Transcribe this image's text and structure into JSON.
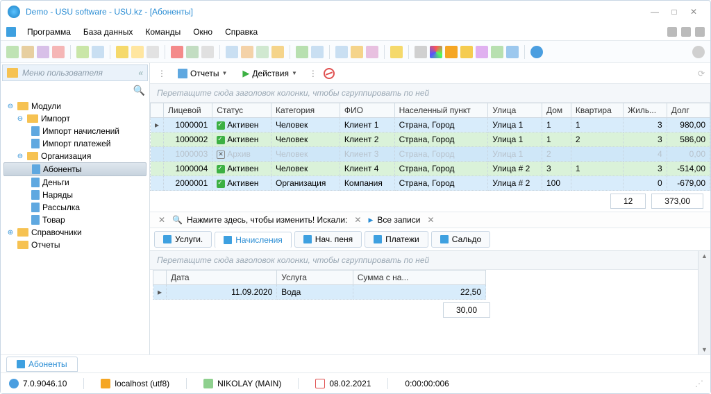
{
  "window": {
    "title": "Demo - USU software - USU.kz - [Абоненты]"
  },
  "menubar": {
    "items": [
      "Программа",
      "База данных",
      "Команды",
      "Окно",
      "Справка"
    ]
  },
  "sidebar": {
    "header": "Меню пользователя",
    "nodes": {
      "modules": "Модули",
      "import": "Импорт",
      "import_nach": "Импорт начислений",
      "import_plat": "Импорт платежей",
      "organization": "Организация",
      "abonents": "Абоненты",
      "money": "Деньги",
      "orders": "Наряды",
      "mailing": "Рассылка",
      "goods": "Товар",
      "refs": "Справочники",
      "reports": "Отчеты"
    }
  },
  "content_toolbar": {
    "reports": "Отчеты",
    "actions": "Действия"
  },
  "groupbar": "Перетащите сюда заголовок колонки, чтобы сгруппировать по ней",
  "grid": {
    "headers": [
      "Лицевой",
      "Статус",
      "Категория",
      "ФИО",
      "Населенный пункт",
      "Улица",
      "Дом",
      "Квартира",
      "Жиль...",
      "Долг"
    ],
    "rows": [
      {
        "acct": "1000001",
        "status": "Активен",
        "status_ok": true,
        "cat": "Человек",
        "fio": "Клиент 1",
        "city": "Страна, Город",
        "street": "Улица 1",
        "house": "1",
        "flat": "1",
        "people": "3",
        "debt": "980,00"
      },
      {
        "acct": "1000002",
        "status": "Активен",
        "status_ok": true,
        "cat": "Человек",
        "fio": "Клиент 2",
        "city": "Страна, Город",
        "street": "Улица 1",
        "house": "1",
        "flat": "2",
        "people": "3",
        "debt": "586,00"
      },
      {
        "acct": "1000003",
        "status": "Архив",
        "status_ok": false,
        "cat": "Человек",
        "fio": "Клиент 3",
        "city": "Страна, Город",
        "street": "Улица 1",
        "house": "2",
        "flat": "",
        "people": "4",
        "debt": "0,00",
        "inactive": true
      },
      {
        "acct": "1000004",
        "status": "Активен",
        "status_ok": true,
        "cat": "Человек",
        "fio": "Клиент 4",
        "city": "Страна, Город",
        "street": "Улица # 2",
        "house": "3",
        "flat": "1",
        "people": "3",
        "debt": "-514,00"
      },
      {
        "acct": "2000001",
        "status": "Активен",
        "status_ok": true,
        "cat": "Организация",
        "fio": "Компания",
        "city": "Страна, Город",
        "street": "Улица # 2",
        "house": "100",
        "flat": "",
        "people": "0",
        "debt": "-679,00"
      }
    ],
    "totals": {
      "count": "12",
      "sum": "373,00"
    }
  },
  "filterbar": {
    "text": "Нажмите здесь, чтобы изменить! Искали:",
    "all": "Все записи"
  },
  "subtabs": [
    "Услуги.",
    "Начисления",
    "Нач. пеня",
    "Платежи",
    "Сальдо"
  ],
  "subgrid": {
    "headers": [
      "Дата",
      "Услуга",
      "Сумма с на..."
    ],
    "rows": [
      {
        "date": "11.09.2020",
        "service": "Вода",
        "sum": "22,50"
      }
    ],
    "total": "30,00"
  },
  "bottom_tab": "Абоненты",
  "statusbar": {
    "version": "7.0.9046.10",
    "host": "localhost (utf8)",
    "user": "NIKOLAY (MAIN)",
    "date": "08.02.2021",
    "time": "0:00:00:006"
  }
}
